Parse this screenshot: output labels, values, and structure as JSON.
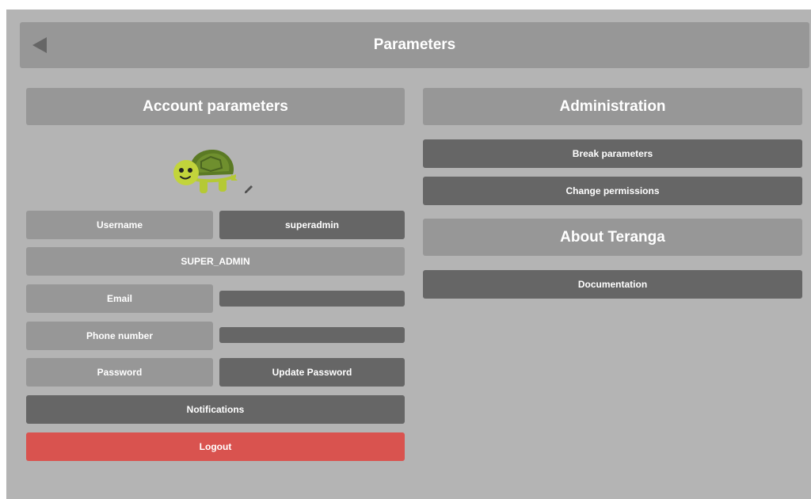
{
  "header": {
    "title": "Parameters",
    "back_icon": "back-arrow-icon"
  },
  "account": {
    "title": "Account parameters",
    "avatar_icon": "turtle-avatar-icon",
    "edit_icon": "pencil-icon",
    "username_label": "Username",
    "username_value": "superadmin",
    "role": "SUPER_ADMIN",
    "email_label": "Email",
    "email_value": "",
    "phone_label": "Phone number",
    "phone_value": "",
    "password_label": "Password",
    "update_password": "Update Password",
    "notifications": "Notifications",
    "logout": "Logout"
  },
  "administration": {
    "title": "Administration",
    "break_parameters": "Break parameters",
    "change_permissions": "Change permissions"
  },
  "about": {
    "title": "About Teranga",
    "documentation": "Documentation"
  },
  "colors": {
    "background": "#b4b4b4",
    "light_panel": "#979797",
    "dark_panel": "#666666",
    "logout": "#d9534f"
  }
}
